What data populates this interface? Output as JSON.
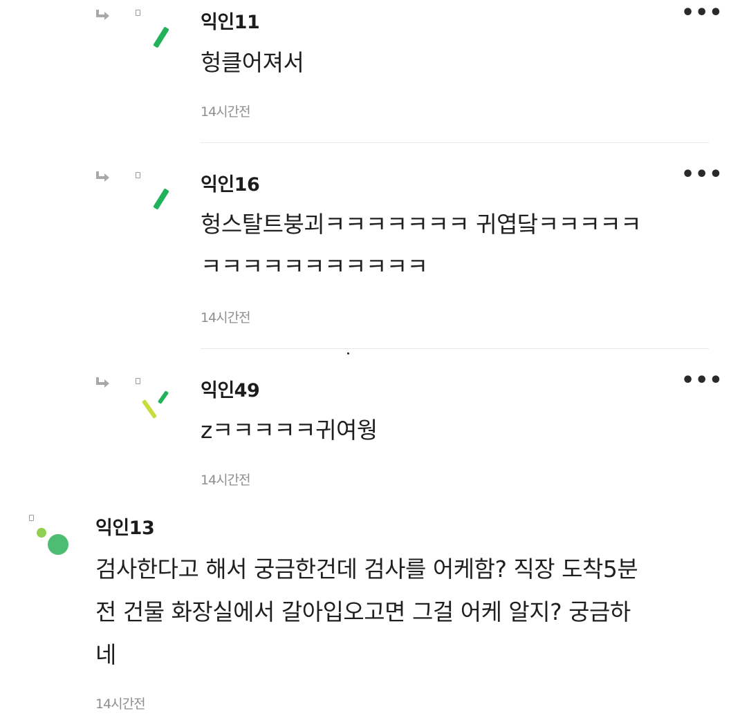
{
  "comments": [
    {
      "name": "익인11",
      "text": "헝클어져서",
      "time": "14시간전"
    },
    {
      "name": "익인16",
      "text_line1": "헝스탈트붕괴ㅋㅋㅋㅋㅋㅋㅋ 귀엽닼ㅋㅋㅋㅋㅋ",
      "text_line2": "ㅋㅋㅋㅋㅋㅋㅋㅋㅋㅋㅋ",
      "time": "14시간전"
    },
    {
      "name": "익인49",
      "text": "zㅋㅋㅋㅋㅋ귀여웡",
      "time": "14시간전"
    },
    {
      "name": "익인13",
      "text_line1": "검사한다고 해서 궁금한건데 검사를 어케함? 직장 도착5분",
      "text_line2": "전 건물 화장실에서 갈아입오고면 그걸 어케 알지? 궁금하",
      "text_line3": "네",
      "time": "14시간전"
    }
  ],
  "more_label": "•••",
  "icons": {
    "reply": "reply-arrow-icon",
    "more": "more-options-icon",
    "avatar": "avatar-icon"
  },
  "colors": {
    "green": "#22b35a",
    "lime": "#c8dc3c",
    "light_green": "#8fd14f",
    "avatar_circle": "#4dbd74"
  }
}
